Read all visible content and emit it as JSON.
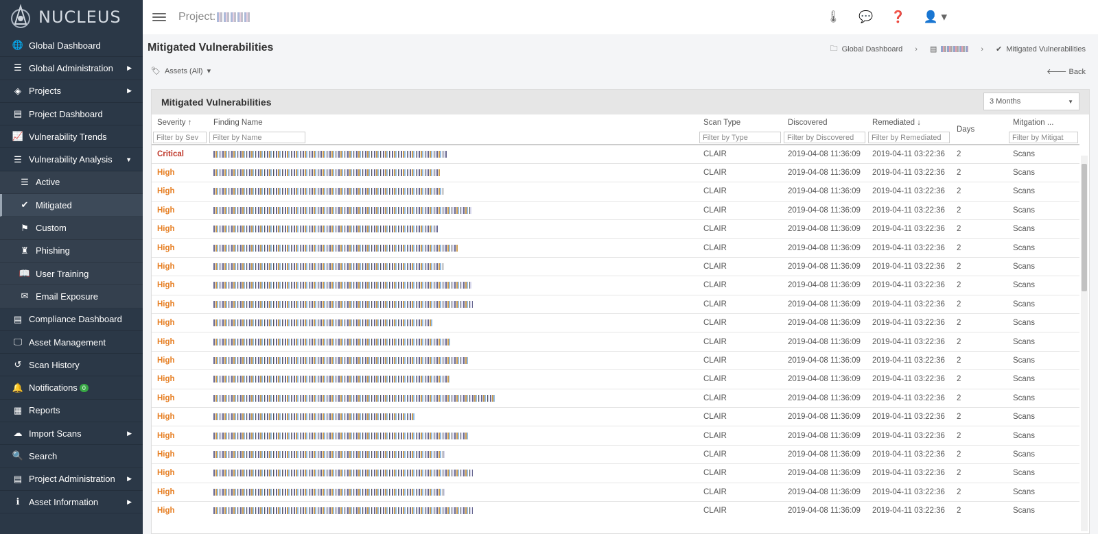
{
  "app": {
    "name": "NUCLEUS"
  },
  "sidebar": {
    "items": [
      {
        "label": "Global Dashboard",
        "icon": "globe-icon",
        "has_children": false
      },
      {
        "label": "Global Administration",
        "icon": "list-icon",
        "has_children": true
      },
      {
        "label": "Projects",
        "icon": "layers-icon",
        "has_children": true
      },
      {
        "label": "Project Dashboard",
        "icon": "table-icon",
        "has_children": false
      },
      {
        "label": "Vulnerability Trends",
        "icon": "line-chart-icon",
        "has_children": false
      },
      {
        "label": "Vulnerability Analysis",
        "icon": "list-icon",
        "has_children": true,
        "expanded": true
      },
      {
        "label": "Active",
        "icon": "list-icon",
        "sub": true
      },
      {
        "label": "Mitigated",
        "icon": "check-icon",
        "sub": true,
        "selected": true
      },
      {
        "label": "Custom",
        "icon": "flag-icon",
        "sub": true
      },
      {
        "label": "Phishing",
        "icon": "fishing-icon",
        "sub": true
      },
      {
        "label": "User Training",
        "icon": "book-icon",
        "sub": true
      },
      {
        "label": "Email Exposure",
        "icon": "envelope-icon",
        "sub": true
      },
      {
        "label": "Compliance Dashboard",
        "icon": "table-icon",
        "has_children": false
      },
      {
        "label": "Asset Management",
        "icon": "desktop-icon",
        "has_children": false
      },
      {
        "label": "Scan History",
        "icon": "history-icon",
        "has_children": false
      },
      {
        "label": "Notifications",
        "icon": "bell-icon",
        "has_children": false,
        "badge": "0"
      },
      {
        "label": "Reports",
        "icon": "grid-icon",
        "has_children": false
      },
      {
        "label": "Import Scans",
        "icon": "cloud-upload-icon",
        "has_children": true
      },
      {
        "label": "Search",
        "icon": "search-icon",
        "has_children": false
      },
      {
        "label": "Project Administration",
        "icon": "table-icon",
        "has_children": true
      },
      {
        "label": "Asset Information",
        "icon": "info-icon",
        "has_children": true
      }
    ]
  },
  "topbar": {
    "project_label": "Project:",
    "icons": [
      "thermometer-icon",
      "comments-icon",
      "help-icon",
      "user-icon"
    ]
  },
  "page": {
    "title": "Mitigated Vulnerabilities",
    "breadcrumb": {
      "home": "Global Dashboard",
      "current": "Mitigated Vulnerabilities"
    },
    "assets_filter": "Assets (All)",
    "back_label": "Back"
  },
  "panel": {
    "title": "Mitigated Vulnerabilities",
    "range": "3 Months"
  },
  "table": {
    "columns": [
      "Severity",
      "Finding Name",
      "Scan Type",
      "Discovered",
      "Remediated",
      "Days",
      "Mitgation ..."
    ],
    "filters": [
      "Filter by Sev",
      "Filter by Name",
      "Filter by Type",
      "Filter by Discovered",
      "Filter by Remediated",
      "Filter by Mitigat"
    ],
    "rows": [
      {
        "severity": "Critical",
        "scan_type": "CLAIR",
        "discovered": "2019-04-08 11:36:09",
        "remediated": "2019-04-11 03:22:36",
        "days": "2",
        "mitigation": "Scans"
      },
      {
        "severity": "High",
        "scan_type": "CLAIR",
        "discovered": "2019-04-08 11:36:09",
        "remediated": "2019-04-11 03:22:36",
        "days": "2",
        "mitigation": "Scans"
      },
      {
        "severity": "High",
        "scan_type": "CLAIR",
        "discovered": "2019-04-08 11:36:09",
        "remediated": "2019-04-11 03:22:36",
        "days": "2",
        "mitigation": "Scans"
      },
      {
        "severity": "High",
        "scan_type": "CLAIR",
        "discovered": "2019-04-08 11:36:09",
        "remediated": "2019-04-11 03:22:36",
        "days": "2",
        "mitigation": "Scans"
      },
      {
        "severity": "High",
        "scan_type": "CLAIR",
        "discovered": "2019-04-08 11:36:09",
        "remediated": "2019-04-11 03:22:36",
        "days": "2",
        "mitigation": "Scans"
      },
      {
        "severity": "High",
        "scan_type": "CLAIR",
        "discovered": "2019-04-08 11:36:09",
        "remediated": "2019-04-11 03:22:36",
        "days": "2",
        "mitigation": "Scans"
      },
      {
        "severity": "High",
        "scan_type": "CLAIR",
        "discovered": "2019-04-08 11:36:09",
        "remediated": "2019-04-11 03:22:36",
        "days": "2",
        "mitigation": "Scans"
      },
      {
        "severity": "High",
        "scan_type": "CLAIR",
        "discovered": "2019-04-08 11:36:09",
        "remediated": "2019-04-11 03:22:36",
        "days": "2",
        "mitigation": "Scans"
      },
      {
        "severity": "High",
        "scan_type": "CLAIR",
        "discovered": "2019-04-08 11:36:09",
        "remediated": "2019-04-11 03:22:36",
        "days": "2",
        "mitigation": "Scans"
      },
      {
        "severity": "High",
        "scan_type": "CLAIR",
        "discovered": "2019-04-08 11:36:09",
        "remediated": "2019-04-11 03:22:36",
        "days": "2",
        "mitigation": "Scans"
      },
      {
        "severity": "High",
        "scan_type": "CLAIR",
        "discovered": "2019-04-08 11:36:09",
        "remediated": "2019-04-11 03:22:36",
        "days": "2",
        "mitigation": "Scans"
      },
      {
        "severity": "High",
        "scan_type": "CLAIR",
        "discovered": "2019-04-08 11:36:09",
        "remediated": "2019-04-11 03:22:36",
        "days": "2",
        "mitigation": "Scans"
      },
      {
        "severity": "High",
        "scan_type": "CLAIR",
        "discovered": "2019-04-08 11:36:09",
        "remediated": "2019-04-11 03:22:36",
        "days": "2",
        "mitigation": "Scans"
      },
      {
        "severity": "High",
        "scan_type": "CLAIR",
        "discovered": "2019-04-08 11:36:09",
        "remediated": "2019-04-11 03:22:36",
        "days": "2",
        "mitigation": "Scans"
      },
      {
        "severity": "High",
        "scan_type": "CLAIR",
        "discovered": "2019-04-08 11:36:09",
        "remediated": "2019-04-11 03:22:36",
        "days": "2",
        "mitigation": "Scans"
      },
      {
        "severity": "High",
        "scan_type": "CLAIR",
        "discovered": "2019-04-08 11:36:09",
        "remediated": "2019-04-11 03:22:36",
        "days": "2",
        "mitigation": "Scans"
      },
      {
        "severity": "High",
        "scan_type": "CLAIR",
        "discovered": "2019-04-08 11:36:09",
        "remediated": "2019-04-11 03:22:36",
        "days": "2",
        "mitigation": "Scans"
      },
      {
        "severity": "High",
        "scan_type": "CLAIR",
        "discovered": "2019-04-08 11:36:09",
        "remediated": "2019-04-11 03:22:36",
        "days": "2",
        "mitigation": "Scans"
      },
      {
        "severity": "High",
        "scan_type": "CLAIR",
        "discovered": "2019-04-08 11:36:09",
        "remediated": "2019-04-11 03:22:36",
        "days": "2",
        "mitigation": "Scans"
      },
      {
        "severity": "High",
        "scan_type": "CLAIR",
        "discovered": "2019-04-08 11:36:09",
        "remediated": "2019-04-11 03:22:36",
        "days": "2",
        "mitigation": "Scans"
      }
    ]
  }
}
